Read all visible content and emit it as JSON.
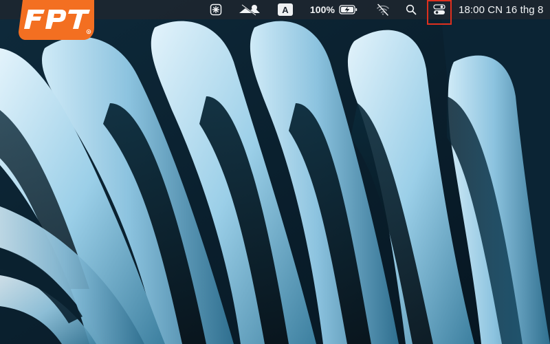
{
  "brand": {
    "logo_text": "FPT",
    "logo_color": "#f36f21"
  },
  "menubar": {
    "battery_percent": "100%",
    "battery_level": 1.0,
    "input_source": "A",
    "clock": "18:00 CN 16 thg 8",
    "icons": [
      "screen-time-icon",
      "eye-off-icon",
      "input-source-icon",
      "battery-charging-icon",
      "wifi-off-icon",
      "search-icon",
      "control-center-icon"
    ]
  },
  "colors": {
    "menubar_bg": "#1e262e",
    "highlight": "#e0301e",
    "wallpaper_light": "#9fd0ea",
    "wallpaper_dark": "#071722"
  }
}
